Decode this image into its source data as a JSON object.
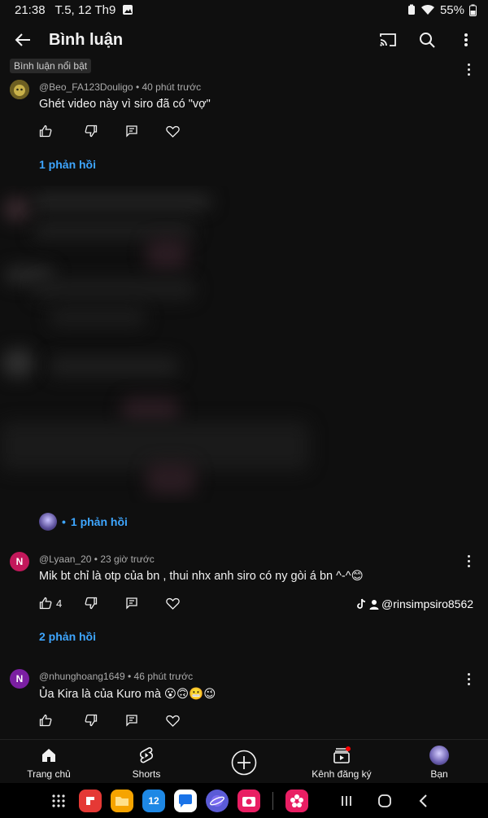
{
  "status_bar": {
    "time": "21:38",
    "date": "T.5, 12 Th9",
    "battery": "55%"
  },
  "app_bar": {
    "title": "Bình luận"
  },
  "pinned_badge": "Bình luận nổi bật",
  "comments": [
    {
      "author": "@Beo_FA123Douligo",
      "time_ago": "40 phút trước",
      "text": "Ghét video này vì siro đã có \"vợ\"",
      "likes": "",
      "replies": "1 phản hồi",
      "avatar_letter": "",
      "avatar_color": "#8a7a2a"
    },
    {
      "author": "@Lyaan_20",
      "time_ago": "23 giờ trước",
      "text": "Mik bt chỉ là otp của bn , thui nhx  anh siro có ny gòi á bn ^-^😊",
      "likes": "4",
      "replies": "2 phản hồi",
      "avatar_letter": "N",
      "avatar_color": "#c2185b"
    },
    {
      "author": "@nhunghoang1649",
      "time_ago": "46 phút trước",
      "text": "Ủa Kira là của Kuro mà 😮🙃😬😉",
      "likes": "",
      "replies": "",
      "avatar_letter": "N",
      "avatar_color": "#7b1fa2"
    }
  ],
  "reply_chip": {
    "sep": "•",
    "label": "1 phản hồi"
  },
  "watermark": {
    "handle": "@rinsimpsiro8562"
  },
  "bottom_nav": [
    {
      "label": "Trang chủ",
      "icon": "home-icon"
    },
    {
      "label": "Shorts",
      "icon": "shorts-icon"
    },
    {
      "label": "",
      "icon": "create-icon"
    },
    {
      "label": "Kênh đăng ký",
      "icon": "subscriptions-icon"
    },
    {
      "label": "Bạn",
      "icon": "profile-avatar"
    }
  ],
  "dock": {
    "calendar_day": "12"
  },
  "colors": {
    "background": "#0f0f0f",
    "link": "#3ea6ff",
    "text": "#f1f1f1",
    "meta": "#aaaaaa"
  }
}
